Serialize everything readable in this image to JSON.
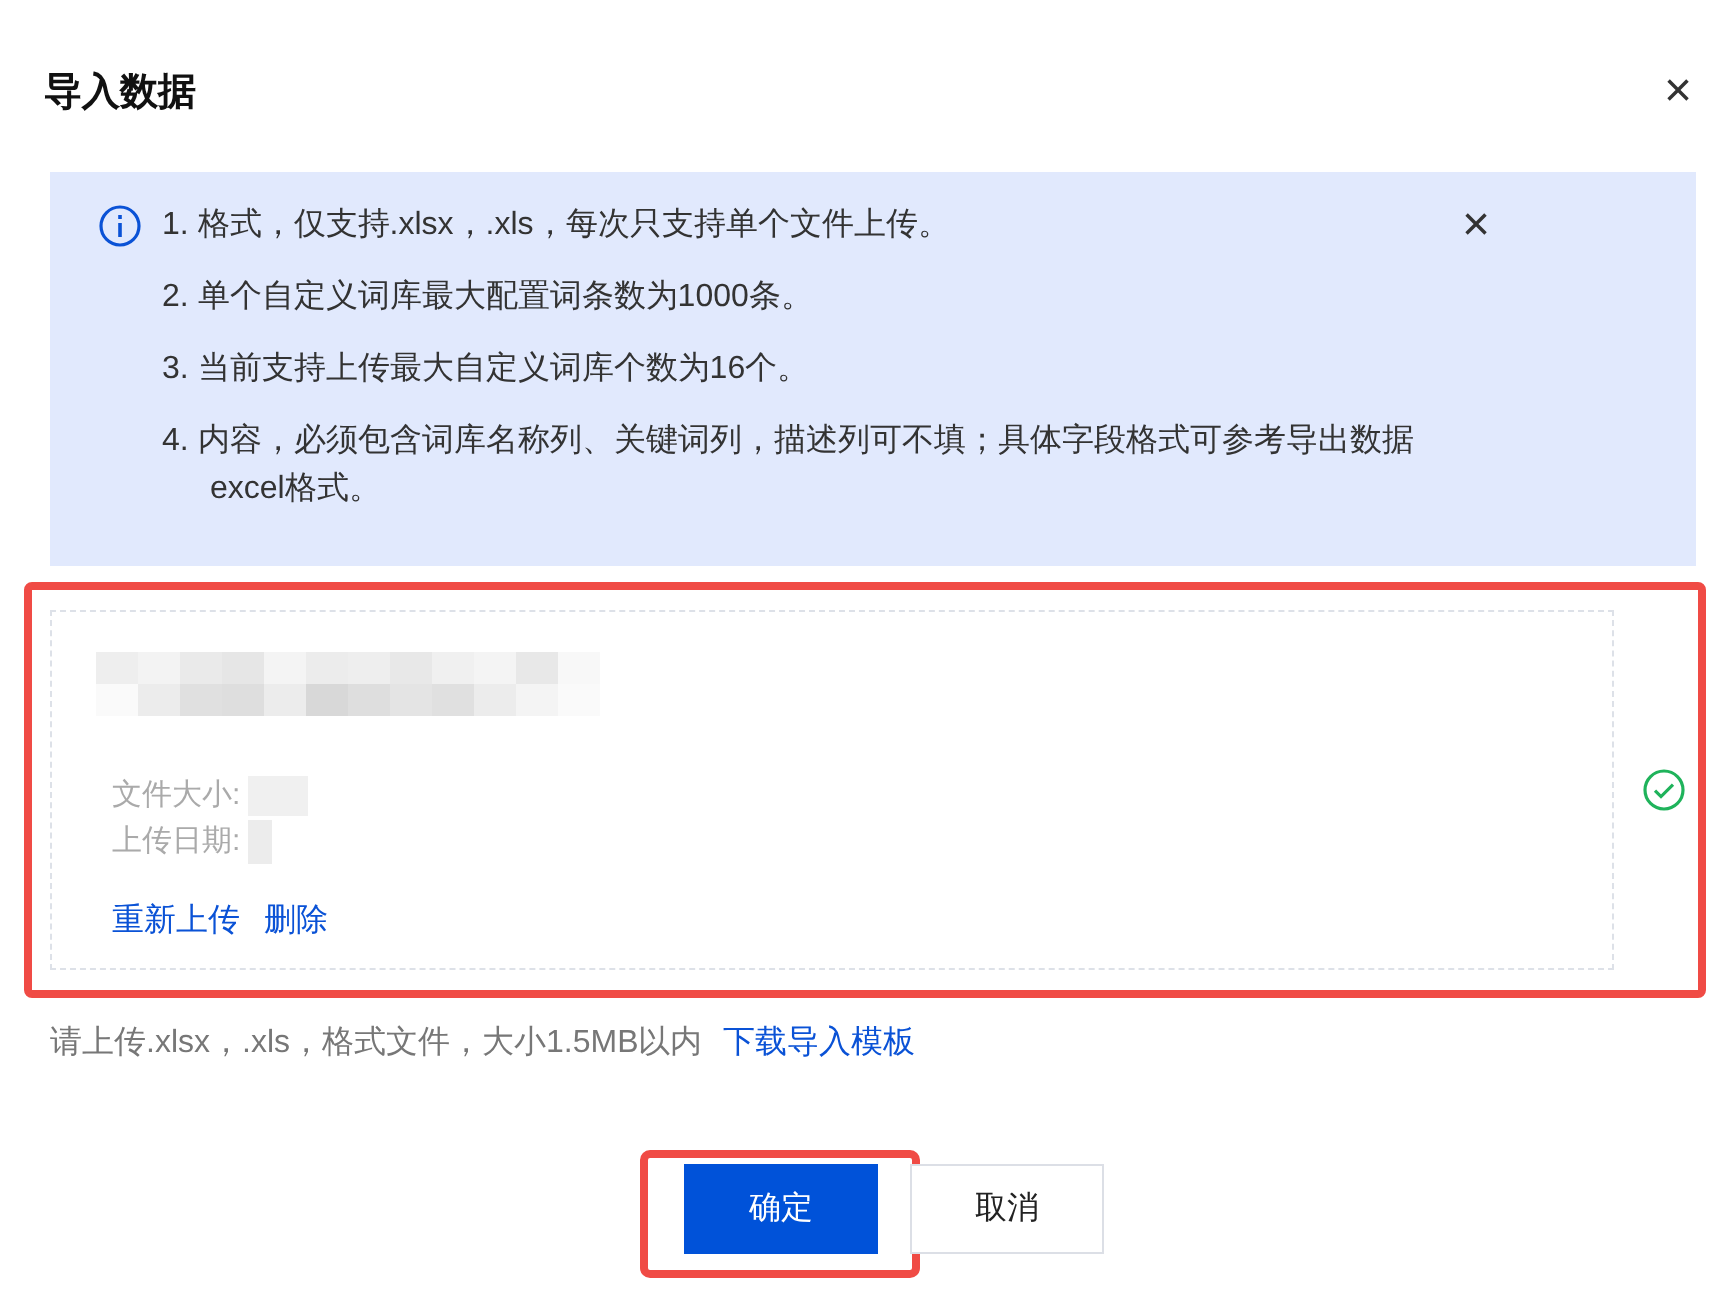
{
  "dialog": {
    "title": "导入数据",
    "close": "×"
  },
  "notice": {
    "items": [
      "1. 格式，仅支持.xlsx，.xls，每次只支持单个文件上传。",
      "2. 单个自定义词库最大配置词条数为1000条。",
      "3. 当前支持上传最大自定义词库个数为16个。",
      "4. 内容，必须包含词库名称列、关键词列，描述列可不填；具体字段格式可参考导出数据excel格式。"
    ],
    "close": "×"
  },
  "file": {
    "size_label": "文件大小:",
    "date_label": "上传日期:",
    "actions": [
      "重新上传",
      "删除"
    ],
    "uploaded": true
  },
  "hint": {
    "text": "请上传.xlsx，.xls，格式文件，大小1.5MB以内",
    "link": "下载导入模板"
  },
  "buttons": [
    {
      "label": "确定",
      "kind": "primary",
      "highlighted": true
    },
    {
      "label": "取消",
      "kind": "default",
      "highlighted": false
    }
  ]
}
